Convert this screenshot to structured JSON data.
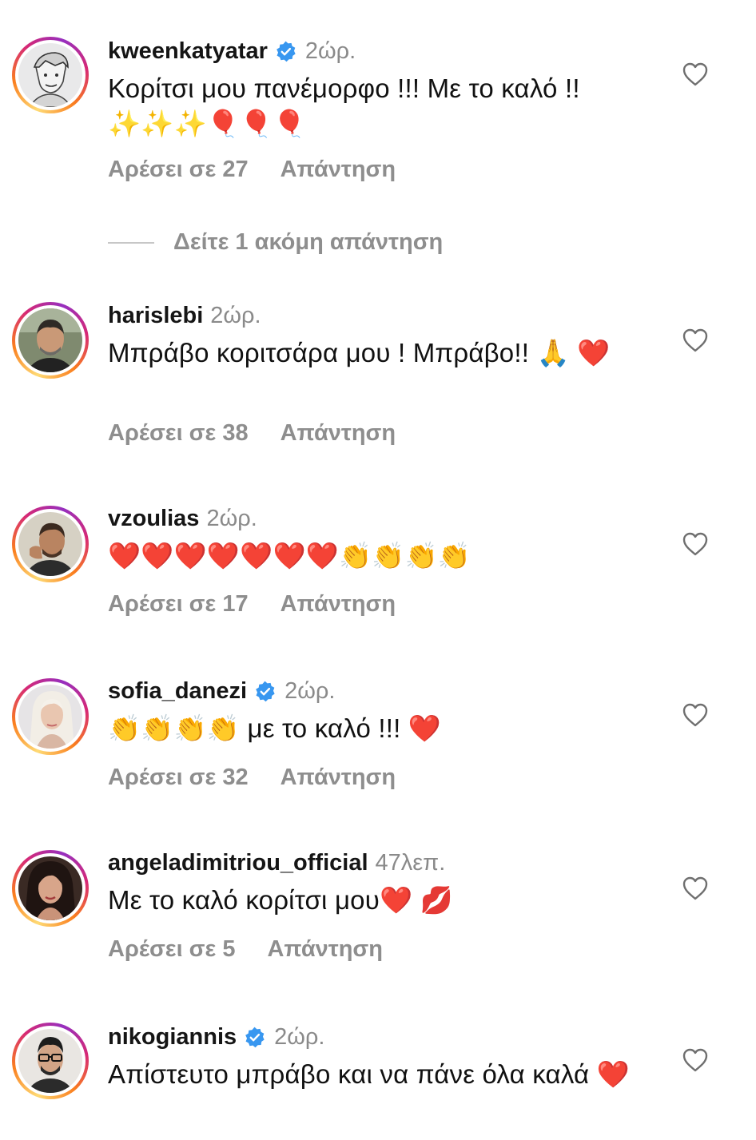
{
  "comments": [
    {
      "username": "kweenkatyatar",
      "verified": true,
      "time": "2ώρ.",
      "text": "Κορίτσι μου πανέμορφο !!! Με το καλό !! ✨✨✨🎈🎈🎈",
      "likes": "Αρέσει σε 27",
      "reply": "Απάντηση"
    },
    {
      "username": "harislebi",
      "verified": false,
      "time": "2ώρ.",
      "text": "Μπράβο κοριτσάρα μου ! Μπράβο!! 🙏 ❤️",
      "likes": "Αρέσει σε 38",
      "reply": "Απάντηση"
    },
    {
      "username": "vzoulias",
      "verified": false,
      "time": "2ώρ.",
      "text": "❤️❤️❤️❤️❤️❤️❤️👏👏👏👏",
      "likes": "Αρέσει σε 17",
      "reply": "Απάντηση"
    },
    {
      "username": "sofia_danezi",
      "verified": true,
      "time": "2ώρ.",
      "text": "👏👏👏👏 με το καλό !!! ❤️",
      "likes": "Αρέσει σε 32",
      "reply": "Απάντηση"
    },
    {
      "username": "angeladimitriou_official",
      "verified": false,
      "time": "47λεπ.",
      "text": "Με το καλό κορίτσι μου❤️ 💋",
      "likes": "Αρέσει σε 5",
      "reply": "Απάντηση"
    },
    {
      "username": "nikogiannis",
      "verified": true,
      "time": "2ώρ.",
      "text": "Απίστευτο μπράβο και να πάνε όλα καλά ❤️",
      "likes": "",
      "reply": ""
    }
  ],
  "more_replies": "Δείτε 1 ακόμη απάντηση",
  "colors": {
    "verified_blue": "#3897f0",
    "meta_gray": "#8e8e8e",
    "text": "#111111"
  },
  "icons": {
    "like": "heart-outline-icon",
    "verified": "verified-badge-icon"
  }
}
